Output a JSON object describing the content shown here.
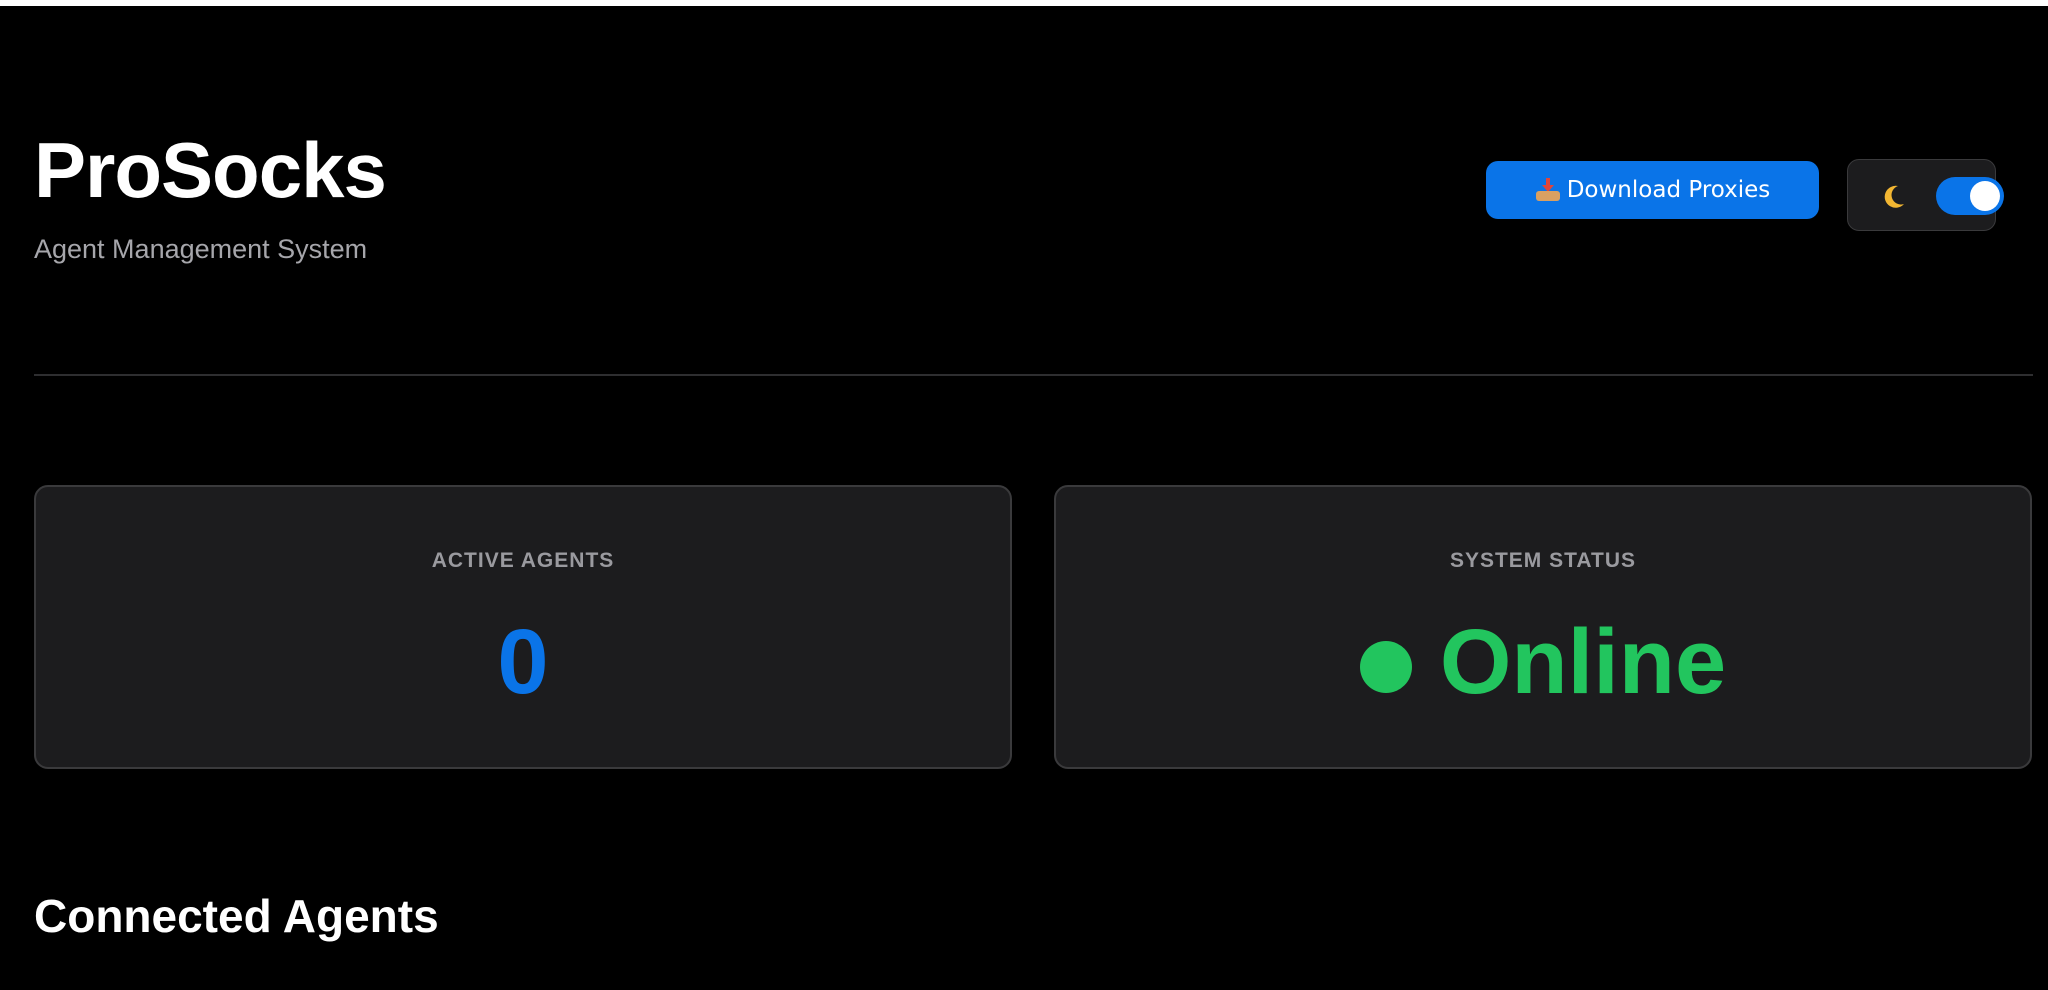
{
  "header": {
    "title": "ProSocks",
    "subtitle": "Agent Management System",
    "download_label": "Download Proxies",
    "download_icon": "inbox-tray-icon",
    "theme_icon": "crescent-moon-icon",
    "theme_toggle_on": true
  },
  "stats": {
    "agents_label": "ACTIVE AGENTS",
    "agents_value": "0",
    "status_label": "SYSTEM STATUS",
    "status_value": "Online"
  },
  "sections": {
    "connected_title": "Connected Agents"
  },
  "colors": {
    "background": "#000000",
    "card": "#1c1c1e",
    "accent_blue": "#0a74e8",
    "status_green": "#22c55e",
    "muted_text": "#9a9a9f"
  }
}
